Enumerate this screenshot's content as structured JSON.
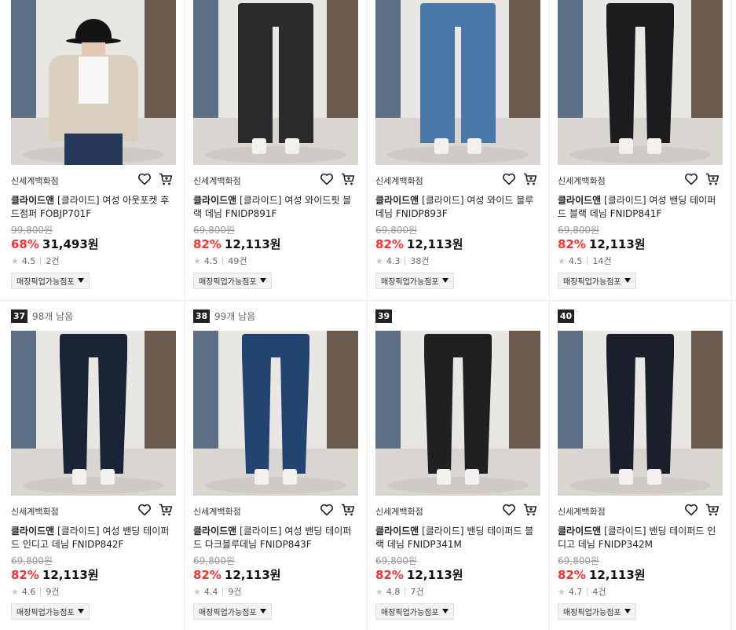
{
  "products": [
    {
      "rank": "",
      "remain": "",
      "store": "신세계백화점",
      "brand": "클라이드앤",
      "name": "[클라이드] 여성 아웃포켓 후드점퍼 FOBJP701F",
      "orig": "99,800원",
      "disc": "68%",
      "price": "31,493원",
      "rating": "4.5",
      "count": "2건",
      "pickup": "매장픽업가능점포",
      "kind": "jacket",
      "color": "#26385a"
    },
    {
      "rank": "",
      "remain": "",
      "store": "신세계백화점",
      "brand": "클라이드앤",
      "name": "[클라이드] 여성 와이드핏 블랙 데님 FNIDP891F",
      "orig": "69,800원",
      "disc": "82%",
      "price": "12,113원",
      "rating": "4.5",
      "count": "49건",
      "pickup": "매장픽업가능점포",
      "kind": "wide",
      "color": "#2a2a2c"
    },
    {
      "rank": "",
      "remain": "",
      "store": "신세계백화점",
      "brand": "클라이드앤",
      "name": "[클라이드] 여성 와이드 블루 데님 FNIDP893F",
      "orig": "69,800원",
      "disc": "82%",
      "price": "12,113원",
      "rating": "4.3",
      "count": "38건",
      "pickup": "매장픽업가능점포",
      "kind": "wide",
      "color": "#4a78a8"
    },
    {
      "rank": "",
      "remain": "",
      "store": "신세계백화점",
      "brand": "클라이드앤",
      "name": "[클라이드] 여성 밴딩 테이퍼드 블랙 데님 FNIDP841F",
      "orig": "69,800원",
      "disc": "82%",
      "price": "12,113원",
      "rating": "4.5",
      "count": "14건",
      "pickup": "매장픽업가능점포",
      "kind": "taper",
      "color": "#1c1c1e"
    },
    {
      "rank": "37",
      "remain": "98개 남음",
      "store": "신세계백화점",
      "brand": "클라이드앤",
      "name": "[클라이드] 여성 밴딩 테이퍼드 인디고 데님 FNIDP842F",
      "orig": "69,800원",
      "disc": "82%",
      "price": "12,113원",
      "rating": "4.6",
      "count": "9건",
      "pickup": "매장픽업가능점포",
      "kind": "taper",
      "color": "#1b2336"
    },
    {
      "rank": "38",
      "remain": "99개 남음",
      "store": "신세계백화점",
      "brand": "클라이드앤",
      "name": "[클라이드] 여성 밴딩 테이퍼드 다크블루데님 FNIDP843F",
      "orig": "69,800원",
      "disc": "82%",
      "price": "12,113원",
      "rating": "4.4",
      "count": "9건",
      "pickup": "매장픽업가능점포",
      "kind": "taper",
      "color": "#23446e"
    },
    {
      "rank": "39",
      "remain": "",
      "store": "신세계백화점",
      "brand": "클라이드앤",
      "name": "[클라이드] 밴딩 테이퍼드 블랙 데님 FNIDP341M",
      "orig": "69,800원",
      "disc": "82%",
      "price": "12,113원",
      "rating": "4.8",
      "count": "7건",
      "pickup": "매장픽업가능점포",
      "kind": "taper",
      "color": "#202022"
    },
    {
      "rank": "40",
      "remain": "",
      "store": "신세계백화점",
      "brand": "클라이드앤",
      "name": "[클라이드] 밴딩 테이퍼드 인디고 데님 FNIDP342M",
      "orig": "69,800원",
      "disc": "82%",
      "price": "12,113원",
      "rating": "4.7",
      "count": "4건",
      "pickup": "매장픽업가능점포",
      "kind": "taper",
      "color": "#1a1f2a"
    }
  ]
}
